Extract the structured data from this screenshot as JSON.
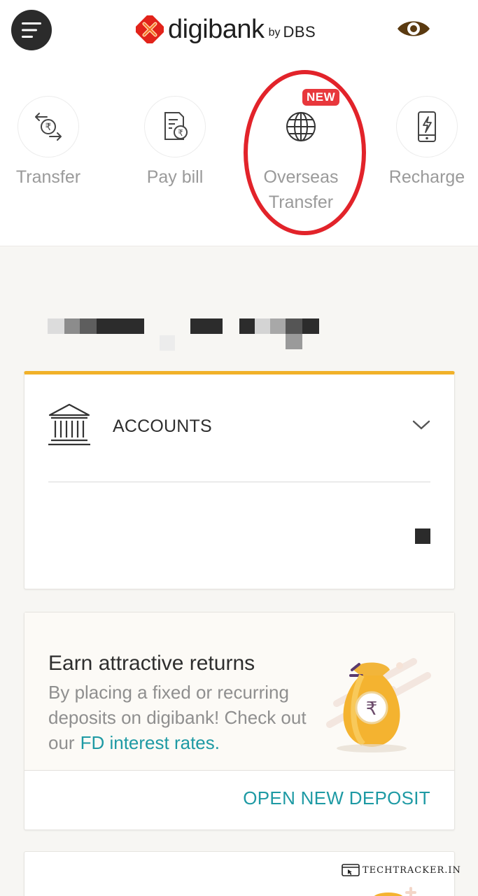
{
  "header": {
    "brand_word": "digibank",
    "brand_by": "by",
    "brand_dbs": "DBS",
    "menu_icon": "hamburger-icon",
    "eye_icon": "eye-icon"
  },
  "quick_actions": [
    {
      "label": "Transfer",
      "icon": "rupee-transfer-icon"
    },
    {
      "label": "Pay bill",
      "icon": "bill-rupee-icon"
    },
    {
      "label_line1": "Overseas",
      "label_line2": "Transfer",
      "icon": "globe-icon",
      "badge": "NEW"
    },
    {
      "label": "Recharge",
      "icon": "mobile-recharge-icon"
    }
  ],
  "accounts": {
    "title": "ACCOUNTS",
    "icon": "bank-building-icon"
  },
  "deposit": {
    "title": "Earn attractive returns",
    "body": "By placing a fixed or recurring deposits on digibank! Check out our",
    "link": "FD interest rates.",
    "button": "OPEN NEW DEPOSIT"
  },
  "watermark": "TECHTRACKER.IN",
  "colors": {
    "accent_teal": "#1e9aa4",
    "accent_gold": "#f1b129",
    "badge_red": "#e8373c",
    "annotation_red": "#e2232a",
    "brand_red": "#e2231a"
  }
}
